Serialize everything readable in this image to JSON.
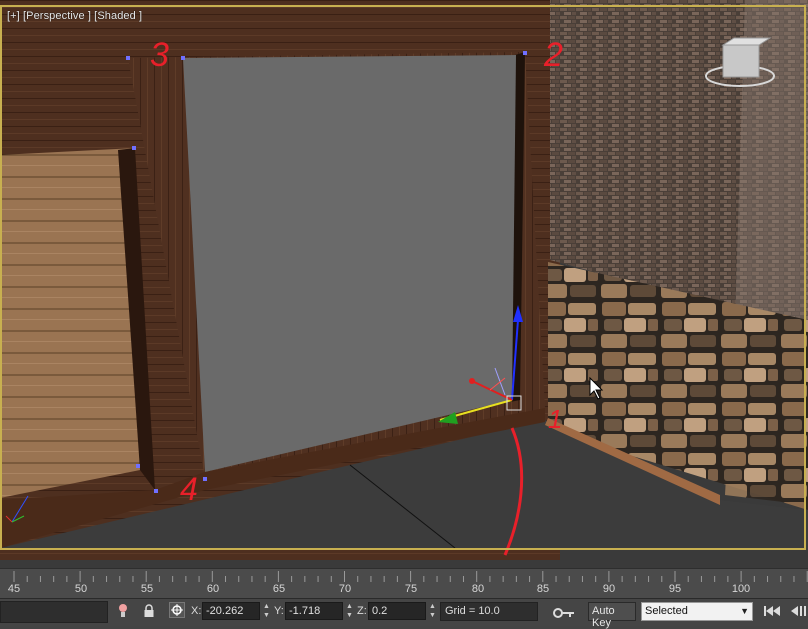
{
  "viewport": {
    "label": "[+] [Perspective ] [Shaded ]",
    "annotations": [
      "3",
      "2",
      "1",
      "4"
    ]
  },
  "ruler": {
    "ticks": [
      "45",
      "50",
      "55",
      "60",
      "65",
      "70",
      "75",
      "80",
      "85",
      "90",
      "95",
      "100"
    ]
  },
  "statusbar": {
    "x_label": "X:",
    "x_value": "-20.262",
    "y_label": "Y:",
    "y_value": "-1.718",
    "z_label": "Z:",
    "z_value": "0.2",
    "grid": "Grid = 10.0",
    "auto_key": "Auto Key",
    "key_filter": "Selected"
  },
  "colors": {
    "viewport_border": "#c8b050",
    "annotation": "#e8202a"
  }
}
